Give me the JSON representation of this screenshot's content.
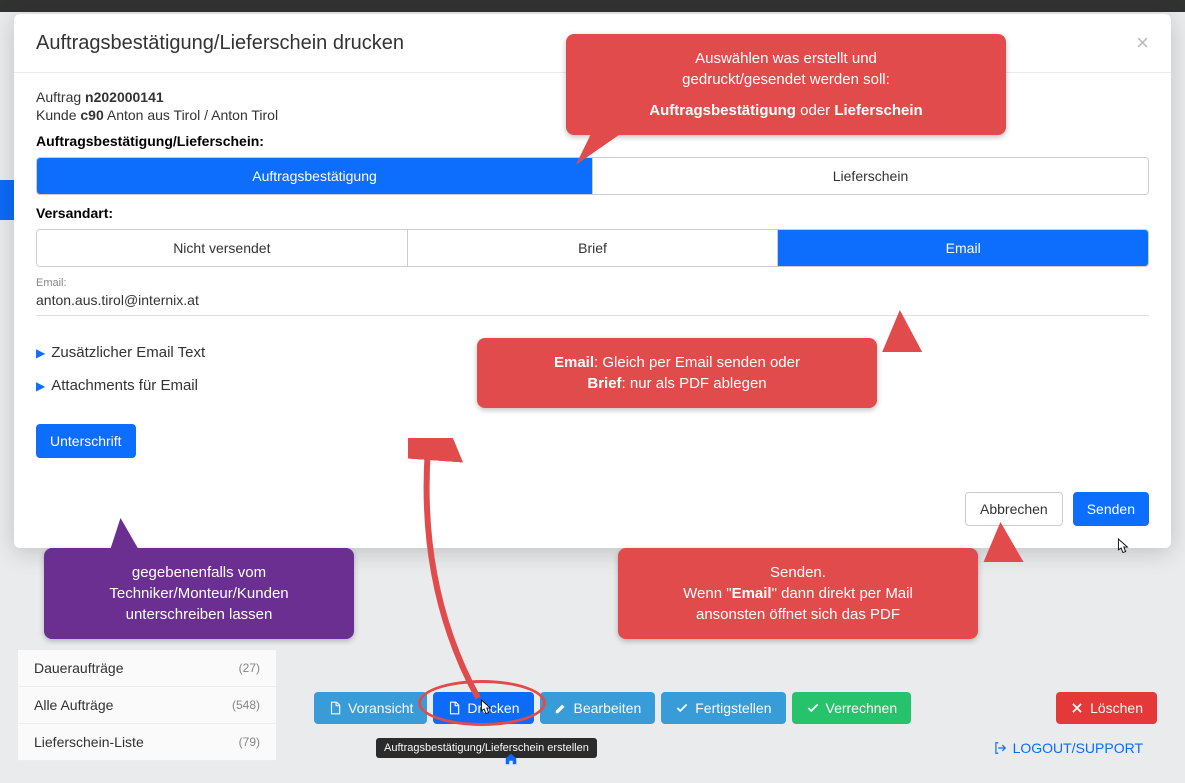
{
  "modal": {
    "title": "Auftragsbestätigung/Lieferschein drucken",
    "order_label": "Auftrag",
    "order_no": "n202000141",
    "customer_label": "Kunde",
    "customer_code": "c90",
    "customer_name": "Anton aus Tirol / Anton Tirol",
    "doctype_label": "Auftragsbestätigung/Lieferschein:",
    "doctype_options": {
      "confirm": "Auftragsbestätigung",
      "delivery": "Lieferschein"
    },
    "shipmethod_label": "Versandart:",
    "shipmethod_options": {
      "none": "Nicht versendet",
      "letter": "Brief",
      "email": "Email"
    },
    "email_label": "Email:",
    "email_value": "anton.aus.tirol@internix.at",
    "accordion": {
      "extra_text": "Zusätzlicher Email Text",
      "attachments": "Attachments für Email"
    },
    "signature_btn": "Unterschrift",
    "cancel_btn": "Abbrechen",
    "send_btn": "Senden"
  },
  "callouts": {
    "c1_line1": "Auswählen was erstellt und",
    "c1_line2": "gedruckt/gesendet werden soll:",
    "c1_b1": "Auftragsbestätigung",
    "c1_mid": " oder ",
    "c1_b2": "Lieferschein",
    "c2_b1": "Email",
    "c2_t1": ": Gleich per Email senden oder",
    "c2_b2": "Brief",
    "c2_t2": ": nur als PDF ablegen",
    "c3_line1": "Senden.",
    "c3_line2a": "Wenn \"",
    "c3_b": "Email",
    "c3_line2b": "\" dann direkt per Mail",
    "c3_line3": "ansonsten öffnet sich das PDF",
    "c4_line1": "gegebenenfalls vom",
    "c4_line2": "Techniker/Monteur/Kunden",
    "c4_line3": "unterschreiben lassen"
  },
  "sidebar": {
    "items": [
      {
        "label": "Daueraufträge",
        "count": "(27)"
      },
      {
        "label": "Alle Aufträge",
        "count": "(548)"
      },
      {
        "label": "Lieferschein-Liste",
        "count": "(79)"
      }
    ]
  },
  "toolbar": {
    "preview": "Voransicht",
    "print": "Drucken",
    "edit": "Bearbeiten",
    "complete": "Fertigstellen",
    "invoice": "Verrechnen",
    "delete": "Löschen"
  },
  "tooltip": "Auftragsbestätigung/Lieferschein erstellen",
  "footer_link": "LOGOUT/SUPPORT"
}
